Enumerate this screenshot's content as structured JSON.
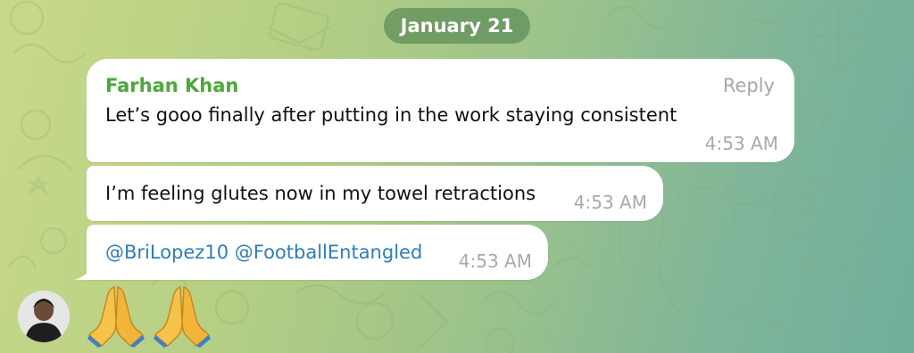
{
  "chat": {
    "date_label": "January 21",
    "messages": [
      {
        "sender": "Farhan Khan",
        "reply_label": "Reply",
        "text": "Let’s gooo finally after putting in the work staying consistent",
        "time": "4:53 AM"
      },
      {
        "text": "I’m feeling glutes  now in my towel retractions",
        "time": "4:53 AM"
      },
      {
        "mentions": [
          "@BriLopez10",
          "@FootballEntangled"
        ],
        "time": "4:53 AM"
      }
    ],
    "reactions": {
      "emoji_names": [
        "folded-hands-icon",
        "folded-hands-icon"
      ],
      "emoji_count": 2
    }
  },
  "colors": {
    "sender_name": "#4aa93a",
    "mention_link": "#2b7ec1",
    "timestamp": "#a9a9a9",
    "date_pill": "#5c8c58"
  }
}
